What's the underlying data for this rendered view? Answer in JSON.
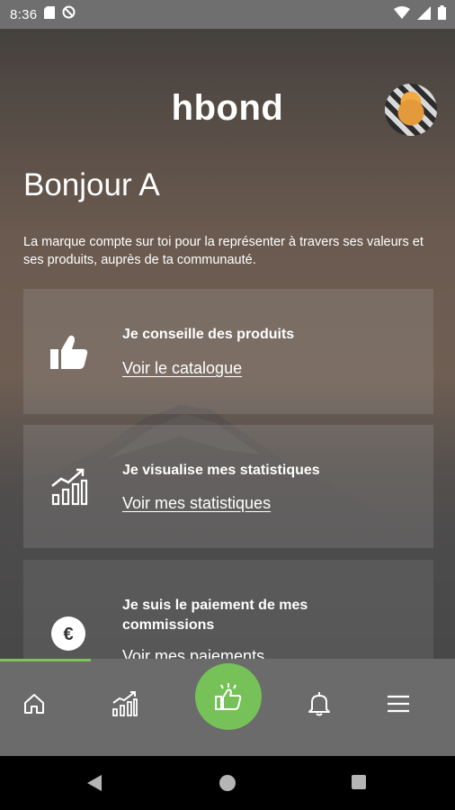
{
  "status_bar": {
    "time": "8:36"
  },
  "header": {
    "logo_text": "hbond"
  },
  "greeting": "Bonjour A",
  "intro_text": "La marque compte sur toi pour la représenter à travers ses valeurs et ses produits, auprès de ta communauté.",
  "cards": [
    {
      "title": "Je conseille des produits",
      "link": "Voir le catalogue",
      "icon": "thumbs-up-icon"
    },
    {
      "title": "Je visualise mes statistiques",
      "link": "Voir mes statistiques",
      "icon": "stats-chart-icon"
    },
    {
      "title": "Je suis le paiement de mes commissions",
      "link": "Voir mes paiements",
      "icon": "euro-icon"
    }
  ],
  "bottom_nav": {
    "items": [
      "home-icon",
      "stats-icon",
      "recommend-icon",
      "bell-icon",
      "menu-icon"
    ],
    "accent": "#76c158"
  }
}
